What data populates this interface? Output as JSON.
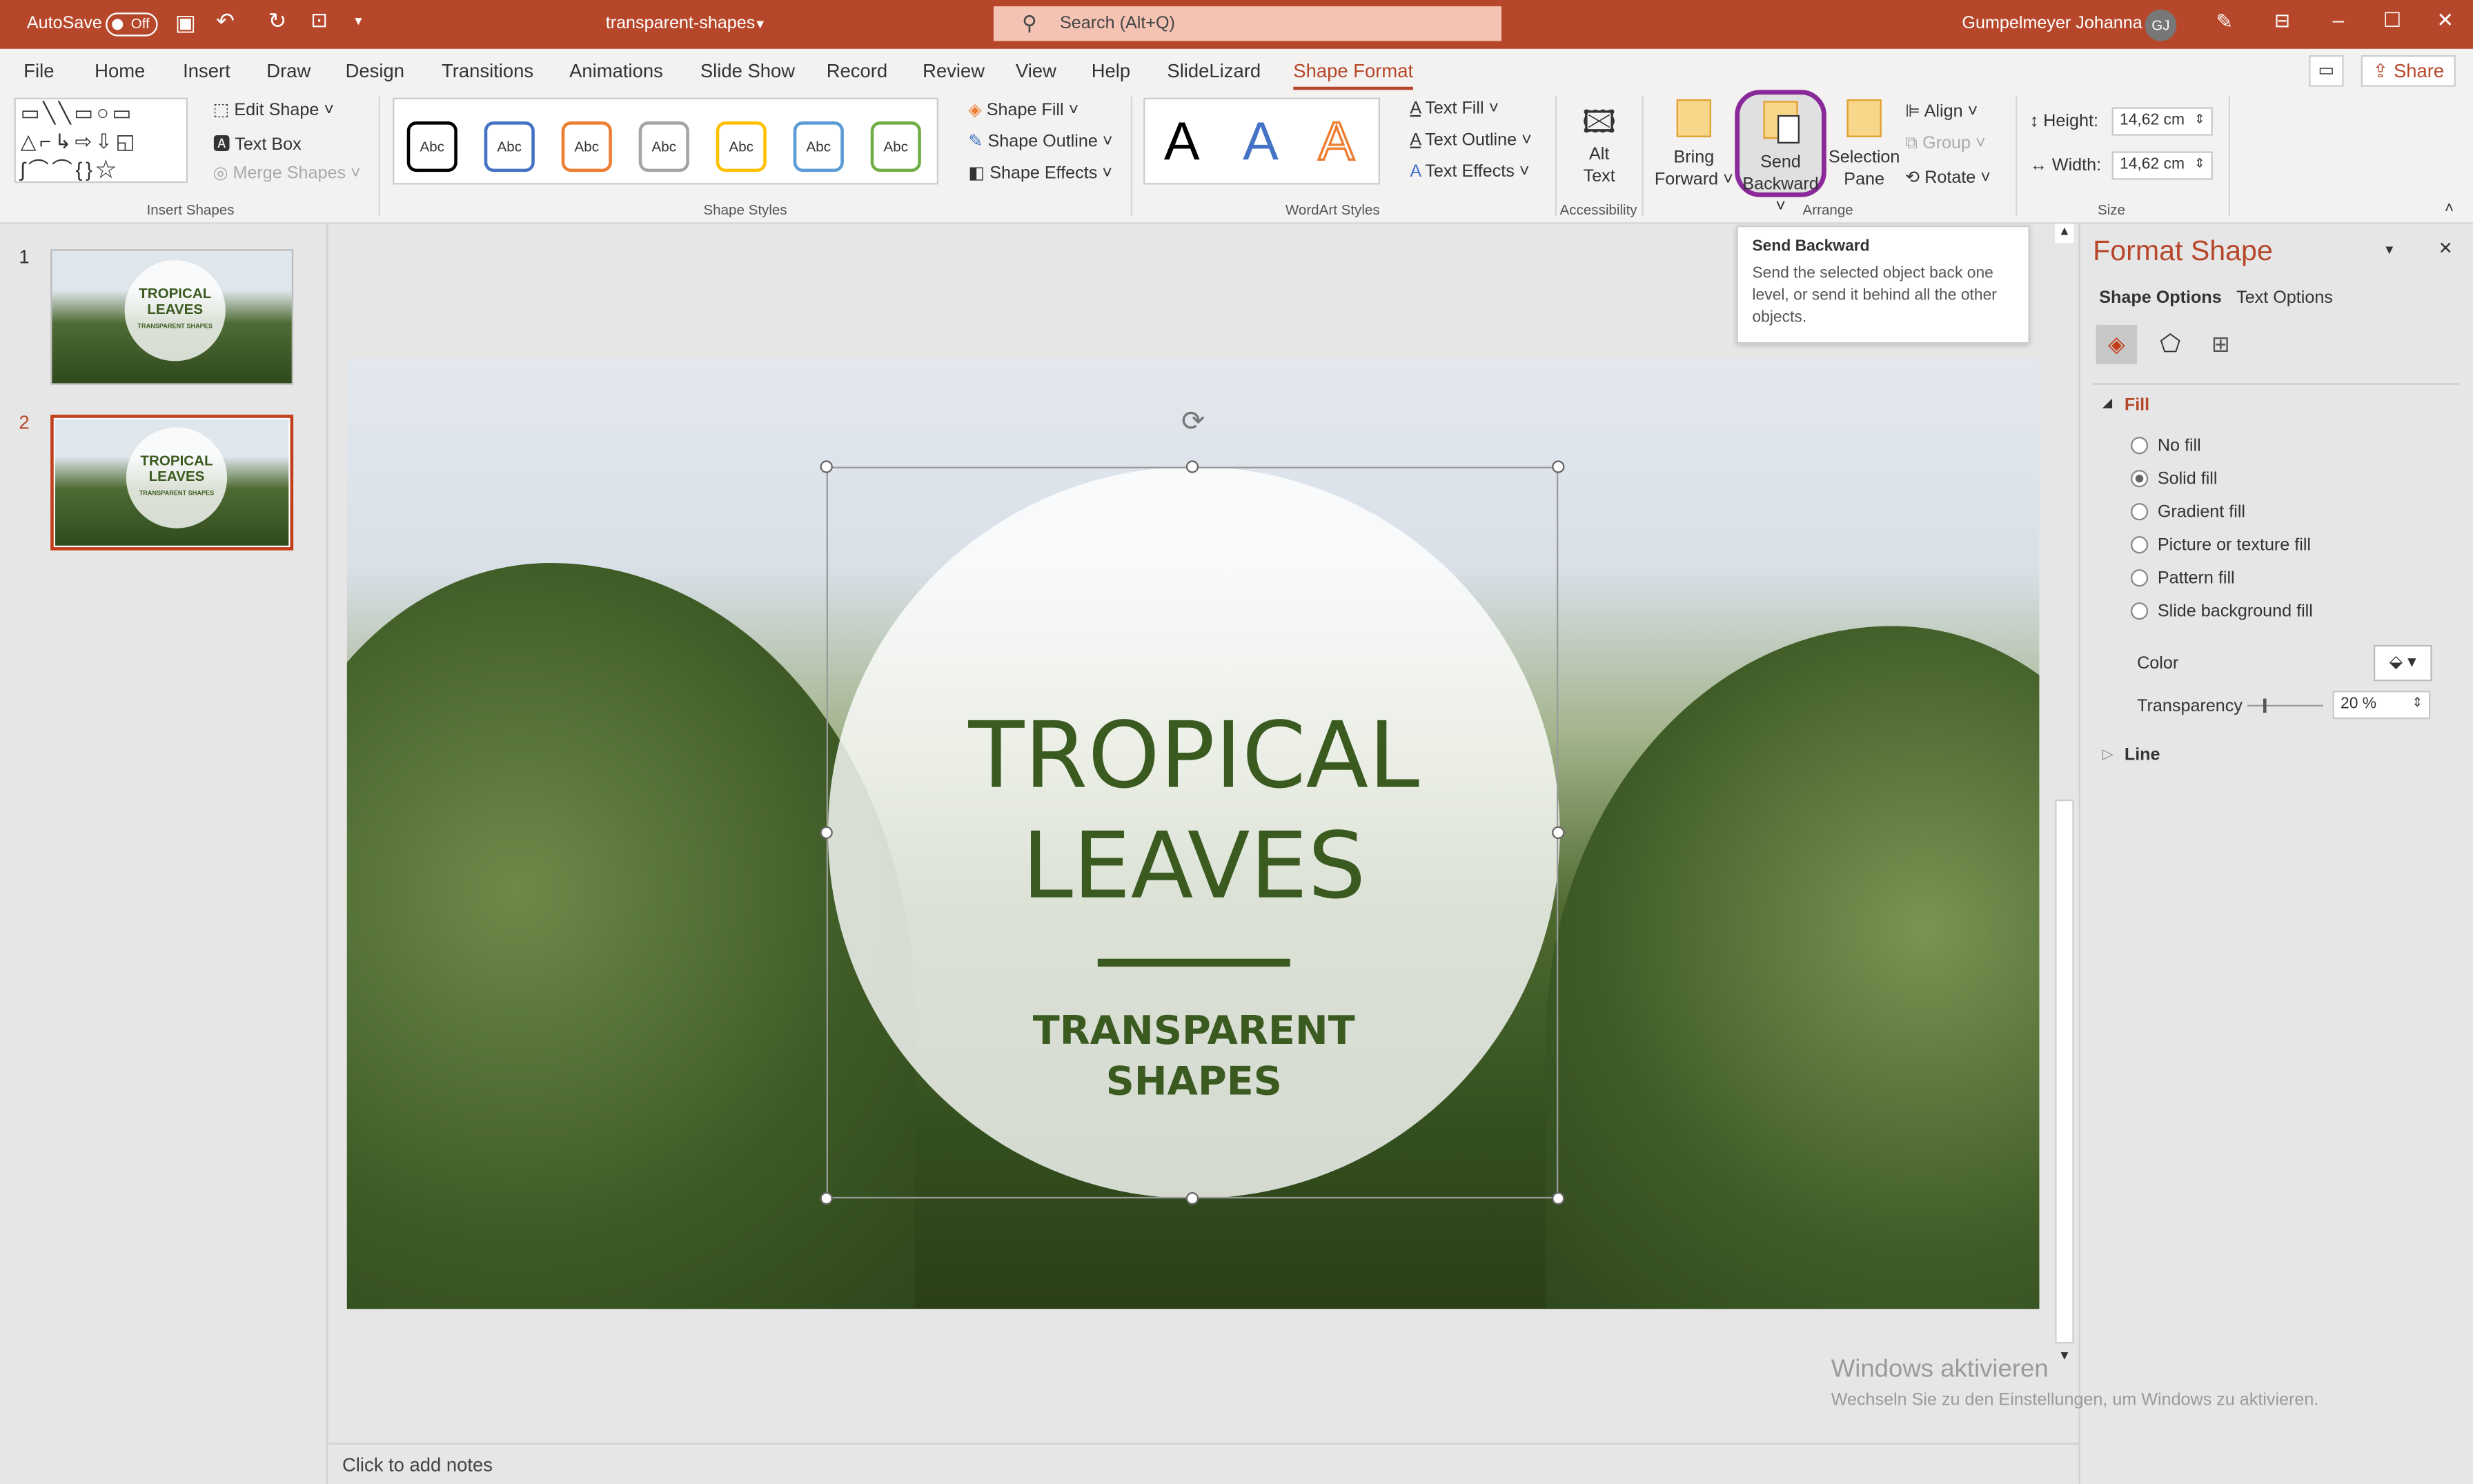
{
  "titlebar": {
    "autosave": "AutoSave",
    "autosave_state": "Off",
    "doc_title": "transparent-shapes",
    "search_placeholder": "Search (Alt+Q)",
    "user": "Gumpelmeyer Johanna",
    "initials": "GJ"
  },
  "menu": {
    "tabs": [
      "File",
      "Home",
      "Insert",
      "Draw",
      "Design",
      "Transitions",
      "Animations",
      "Slide Show",
      "Record",
      "Review",
      "View",
      "Help",
      "SlideLizard",
      "Shape Format"
    ],
    "active": "Shape Format",
    "share": "Share"
  },
  "ribbon": {
    "insert_shapes": {
      "label": "Insert Shapes",
      "edit_shape": "Edit Shape",
      "text_box": "Text Box",
      "merge_shapes": "Merge Shapes"
    },
    "shape_styles": {
      "label": "Shape Styles",
      "swatch": "Abc",
      "swatch_colors": [
        "#000000",
        "#4472c4",
        "#ed7d31",
        "#a5a5a5",
        "#ffc000",
        "#5b9bd5",
        "#70ad47"
      ],
      "shape_fill": "Shape Fill",
      "shape_outline": "Shape Outline",
      "shape_effects": "Shape Effects"
    },
    "wordart": {
      "label": "WordArt Styles",
      "letter": "A",
      "text_fill": "Text Fill",
      "text_outline": "Text Outline",
      "text_effects": "Text Effects"
    },
    "accessibility": {
      "label": "Accessibility",
      "alt_text_1": "Alt",
      "alt_text_2": "Text"
    },
    "arrange": {
      "label": "Arrange",
      "bring_1": "Bring",
      "bring_2": "Forward",
      "send_1": "Send",
      "send_2": "Backward",
      "selection_1": "Selection",
      "selection_2": "Pane",
      "align": "Align",
      "group": "Group",
      "rotate": "Rotate"
    },
    "size": {
      "label": "Size",
      "height_label": "Height:",
      "height": "14,62 cm",
      "width_label": "Width:",
      "width": "14,62 cm"
    }
  },
  "tooltip": {
    "title": "Send Backward",
    "body": "Send the selected object back one level, or send it behind all the other objects."
  },
  "thumbnails": [
    {
      "num": "1",
      "title": "TROPICAL LEAVES",
      "sub": "TRANSPARENT SHAPES"
    },
    {
      "num": "2",
      "title": "TROPICAL LEAVES",
      "sub": "TRANSPARENT SHAPES"
    }
  ],
  "slide": {
    "title_1": "TROPICAL",
    "title_2": "LEAVES",
    "sub_1": "TRANSPARENT",
    "sub_2": "SHAPES",
    "accent": "#3a5a1f"
  },
  "notes": "Click to add notes",
  "pane": {
    "title": "Format Shape",
    "tab_shape": "Shape Options",
    "tab_text": "Text Options",
    "fill": "Fill",
    "options": [
      "No fill",
      "Solid fill",
      "Gradient fill",
      "Picture or texture fill",
      "Pattern fill",
      "Slide background fill"
    ],
    "selected": "Solid fill",
    "color": "Color",
    "transparency": "Transparency",
    "transparency_value": "20 %",
    "transparency_pct": 20,
    "line": "Line"
  },
  "watermark": {
    "line1": "Windows aktivieren",
    "line2": "Wechseln Sie zu den Einstellungen, um Windows zu aktivieren."
  }
}
